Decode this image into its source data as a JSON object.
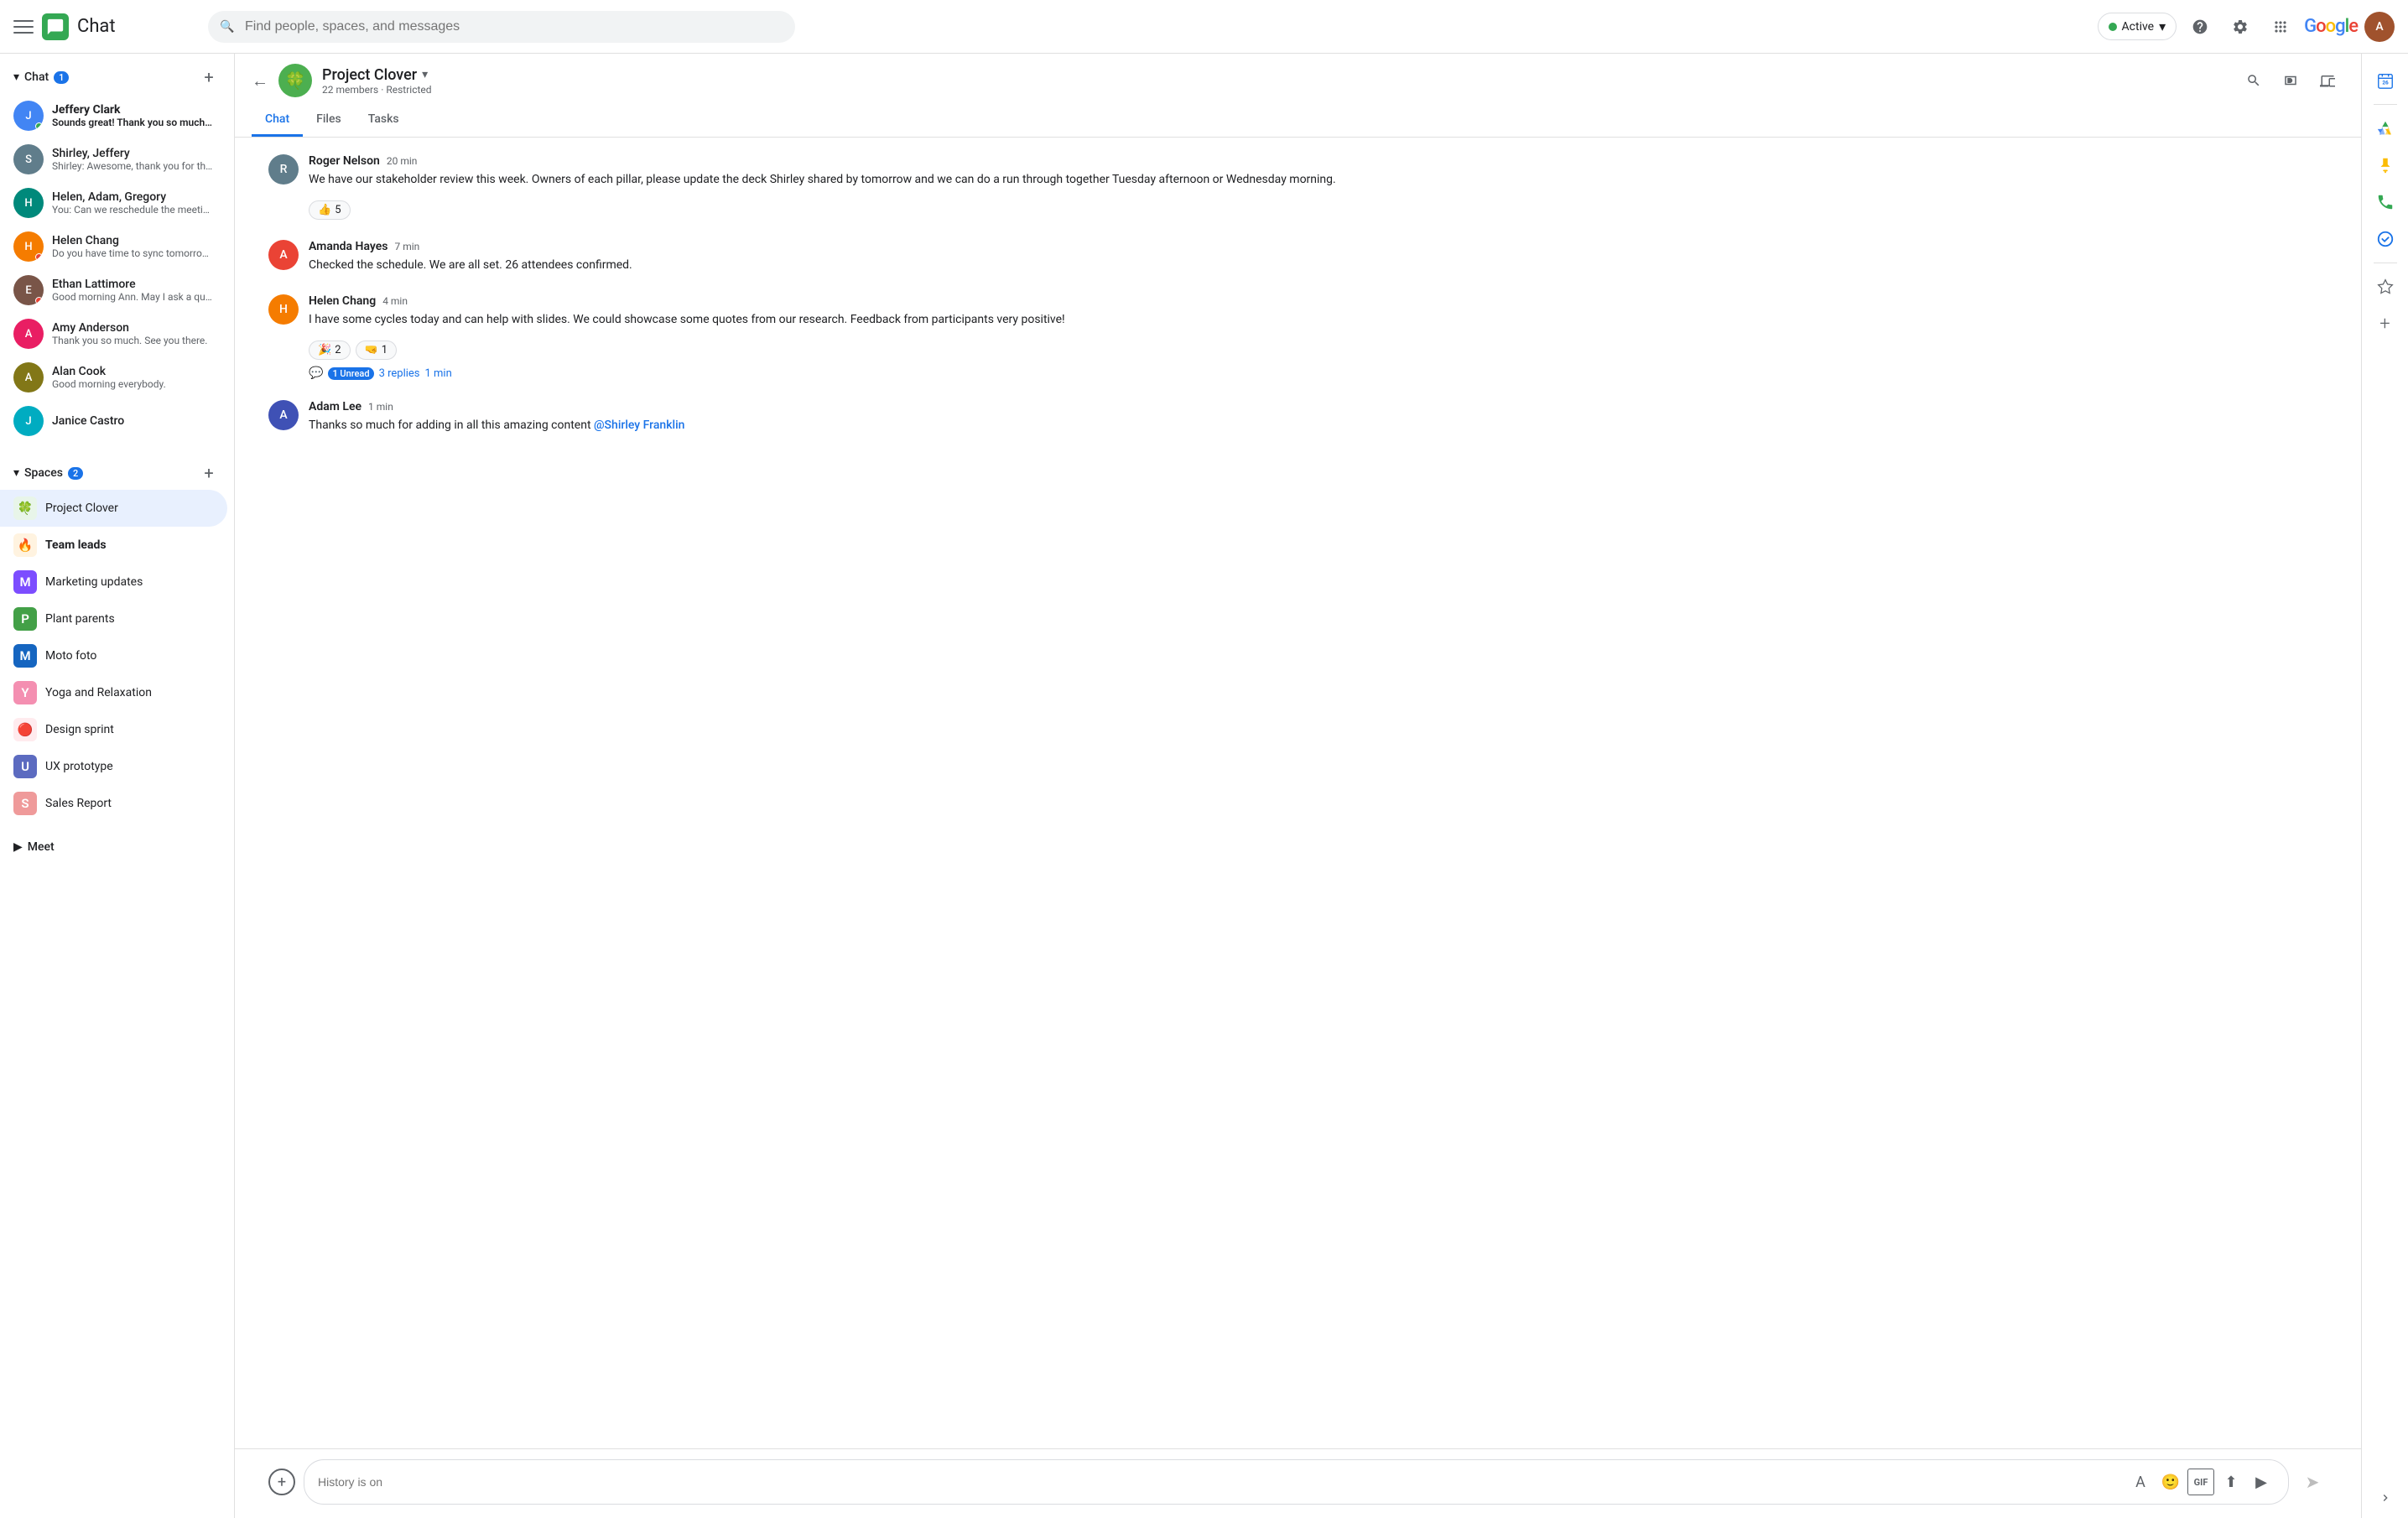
{
  "topbar": {
    "title": "Chat",
    "search_placeholder": "Find people, spaces, and messages",
    "active_label": "Active",
    "google_label": "Google"
  },
  "sidebar": {
    "chat_section": {
      "label": "Chat",
      "badge": "1",
      "items": [
        {
          "id": "jeffery-clark",
          "name": "Jeffery Clark",
          "preview": "Sounds great! Thank you so much Ann!",
          "unread": true,
          "avatar_color": "av-blue",
          "avatar_initial": "J",
          "online": true
        },
        {
          "id": "shirley-jeffery",
          "name": "Shirley, Jeffery",
          "preview": "Shirley: Awesome, thank you for the...",
          "unread": false,
          "avatar_color": "av-gray",
          "avatar_initial": "S"
        },
        {
          "id": "helen-adam-gregory",
          "name": "Helen, Adam, Gregory",
          "preview": "You: Can we reschedule the meeting for...",
          "unread": false,
          "avatar_color": "av-teal",
          "avatar_initial": "H"
        },
        {
          "id": "helen-chang",
          "name": "Helen Chang",
          "preview": "Do you have time to sync tomorrow mori...",
          "unread": false,
          "avatar_color": "av-orange",
          "avatar_initial": "H",
          "dnd": true
        },
        {
          "id": "ethan-lattimore",
          "name": "Ethan Lattimore",
          "preview": "Good morning Ann. May I ask a question?",
          "unread": false,
          "avatar_color": "av-brown",
          "avatar_initial": "E",
          "dnd": true
        },
        {
          "id": "amy-anderson",
          "name": "Amy Anderson",
          "preview": "Thank you so much. See you there.",
          "unread": false,
          "avatar_color": "av-pink",
          "avatar_initial": "A"
        },
        {
          "id": "alan-cook",
          "name": "Alan Cook",
          "preview": "Good morning everybody.",
          "unread": false,
          "avatar_color": "av-lime",
          "avatar_initial": "A"
        },
        {
          "id": "janice-castro",
          "name": "Janice Castro",
          "preview": "",
          "unread": false,
          "avatar_color": "av-cyan",
          "avatar_initial": "J"
        }
      ]
    },
    "spaces_section": {
      "label": "Spaces",
      "badge": "2",
      "items": [
        {
          "id": "project-clover",
          "name": "Project Clover",
          "icon": "🍀",
          "icon_bg": "#e8f5e9",
          "active": true,
          "bold": false
        },
        {
          "id": "team-leads",
          "name": "Team leads",
          "icon": "🔥",
          "icon_bg": "#fff3e0",
          "active": false,
          "bold": true
        },
        {
          "id": "marketing-updates",
          "name": "Marketing updates",
          "icon": "M",
          "icon_bg": "#7c4dff",
          "active": false,
          "bold": false
        },
        {
          "id": "plant-parents",
          "name": "Plant parents",
          "icon": "P",
          "icon_bg": "#43a047",
          "active": false,
          "bold": false
        },
        {
          "id": "moto-foto",
          "name": "Moto foto",
          "icon": "M",
          "icon_bg": "#1565c0",
          "active": false,
          "bold": false
        },
        {
          "id": "yoga-relaxation",
          "name": "Yoga and Relaxation",
          "icon": "Y",
          "icon_bg": "#f48fb1",
          "active": false,
          "bold": false
        },
        {
          "id": "design-sprint",
          "name": "Design sprint",
          "icon": "🔴",
          "icon_bg": "#ffebee",
          "active": false,
          "bold": false
        },
        {
          "id": "ux-prototype",
          "name": "UX prototype",
          "icon": "U",
          "icon_bg": "#5c6bc0",
          "active": false,
          "bold": false
        },
        {
          "id": "sales-report",
          "name": "Sales Report",
          "icon": "S",
          "icon_bg": "#ef9a9a",
          "active": false,
          "bold": false
        }
      ]
    },
    "meet_section": {
      "label": "Meet"
    }
  },
  "chat_header": {
    "space_name": "Project Clover",
    "members": "22 members",
    "restricted": "Restricted",
    "tabs": [
      {
        "id": "chat",
        "label": "Chat",
        "active": true
      },
      {
        "id": "files",
        "label": "Files",
        "active": false
      },
      {
        "id": "tasks",
        "label": "Tasks",
        "active": false
      }
    ]
  },
  "messages": [
    {
      "id": "msg1",
      "sender": "Roger Nelson",
      "time": "20 min",
      "avatar_color": "av-gray",
      "avatar_initial": "R",
      "text": "We have our stakeholder review this week.  Owners of each pillar, please update the deck Shirley shared by tomorrow and we can do a run through together Tuesday afternoon or Wednesday morning.",
      "reactions": [
        {
          "emoji": "👍",
          "count": "5"
        }
      ],
      "thread": null
    },
    {
      "id": "msg2",
      "sender": "Amanda Hayes",
      "time": "7 min",
      "avatar_color": "av-red",
      "avatar_initial": "A",
      "text": "Checked the schedule.  We are all set.  26 attendees confirmed.",
      "reactions": [],
      "thread": null
    },
    {
      "id": "msg3",
      "sender": "Helen Chang",
      "time": "4 min",
      "avatar_color": "av-orange",
      "avatar_initial": "H",
      "text": "I have some cycles today and can help with slides.  We could showcase some quotes from our research.  Feedback from participants very positive!",
      "reactions": [
        {
          "emoji": "🎉",
          "count": "2"
        },
        {
          "emoji": "🤜",
          "count": "1"
        }
      ],
      "thread": {
        "unread": 1,
        "replies": 3,
        "time": "1 min"
      }
    },
    {
      "id": "msg4",
      "sender": "Adam Lee",
      "time": "1 min",
      "avatar_color": "av-indigo",
      "avatar_initial": "A",
      "text": "Thanks so much for adding in all this amazing content ",
      "mention": "@Shirley Franklin",
      "reactions": [],
      "thread": null
    }
  ],
  "input": {
    "placeholder": "History is on"
  },
  "right_sidebar": {
    "icons": [
      {
        "id": "drive",
        "label": "Google Drive",
        "color": "#4285f4"
      },
      {
        "id": "keep",
        "label": "Google Keep",
        "color": "#fbbc05"
      },
      {
        "id": "phone",
        "label": "Google Voice",
        "color": "#34a853"
      },
      {
        "id": "tasks",
        "label": "Google Tasks",
        "color": "#1a73e8"
      },
      {
        "id": "starred",
        "label": "Starred"
      },
      {
        "id": "add",
        "label": "Add apps"
      },
      {
        "id": "calendar",
        "label": "Google Calendar",
        "color": "#1a73e8"
      }
    ]
  }
}
